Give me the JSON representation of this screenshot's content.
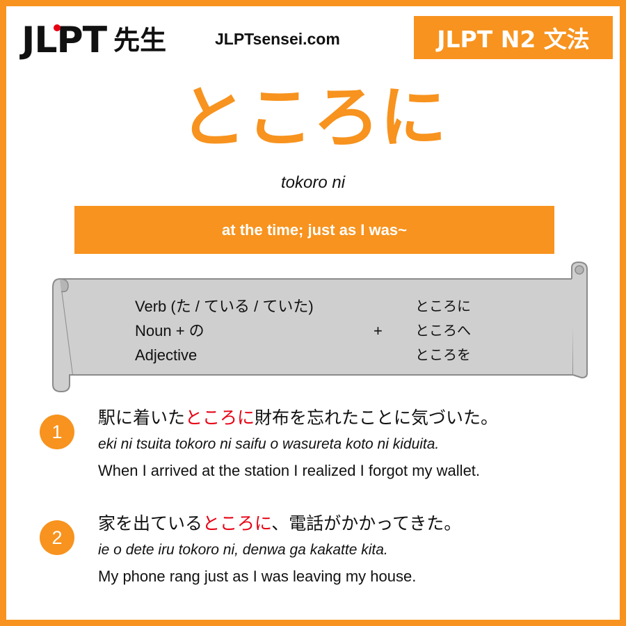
{
  "header": {
    "logo_latin": "JLPT",
    "logo_kanji": "先生",
    "site": "JLPTsensei.com",
    "level": "JLPT N2 文法"
  },
  "grammar": {
    "title": "ところに",
    "romaji": "tokoro ni",
    "meaning": "at the time; just as I was~"
  },
  "formation": {
    "rows": [
      "Verb (た / ている / ていた)",
      "Noun + の",
      "Adjective"
    ],
    "connector": "+",
    "forms": [
      "ところに",
      "ところへ",
      "ところを"
    ]
  },
  "examples": [
    {
      "number": "1",
      "jp_before": "駅に着いた",
      "jp_highlight": "ところに",
      "jp_after": "財布を忘れたことに気づいた。",
      "romaji": "eki ni tsuita tokoro ni saifu o wasureta koto ni kiduita.",
      "english": "When I arrived at the station I realized I forgot my wallet."
    },
    {
      "number": "2",
      "jp_before": "家を出ている",
      "jp_highlight": "ところに",
      "jp_after": "、電話がかかってきた。",
      "romaji": "ie o dete iru tokoro ni, denwa ga kakatte kita.",
      "english": "My phone rang just as I was leaving my house."
    }
  ],
  "colors": {
    "accent": "#f7931e",
    "highlight": "#e60012",
    "scroll": "#cfcfcf"
  }
}
